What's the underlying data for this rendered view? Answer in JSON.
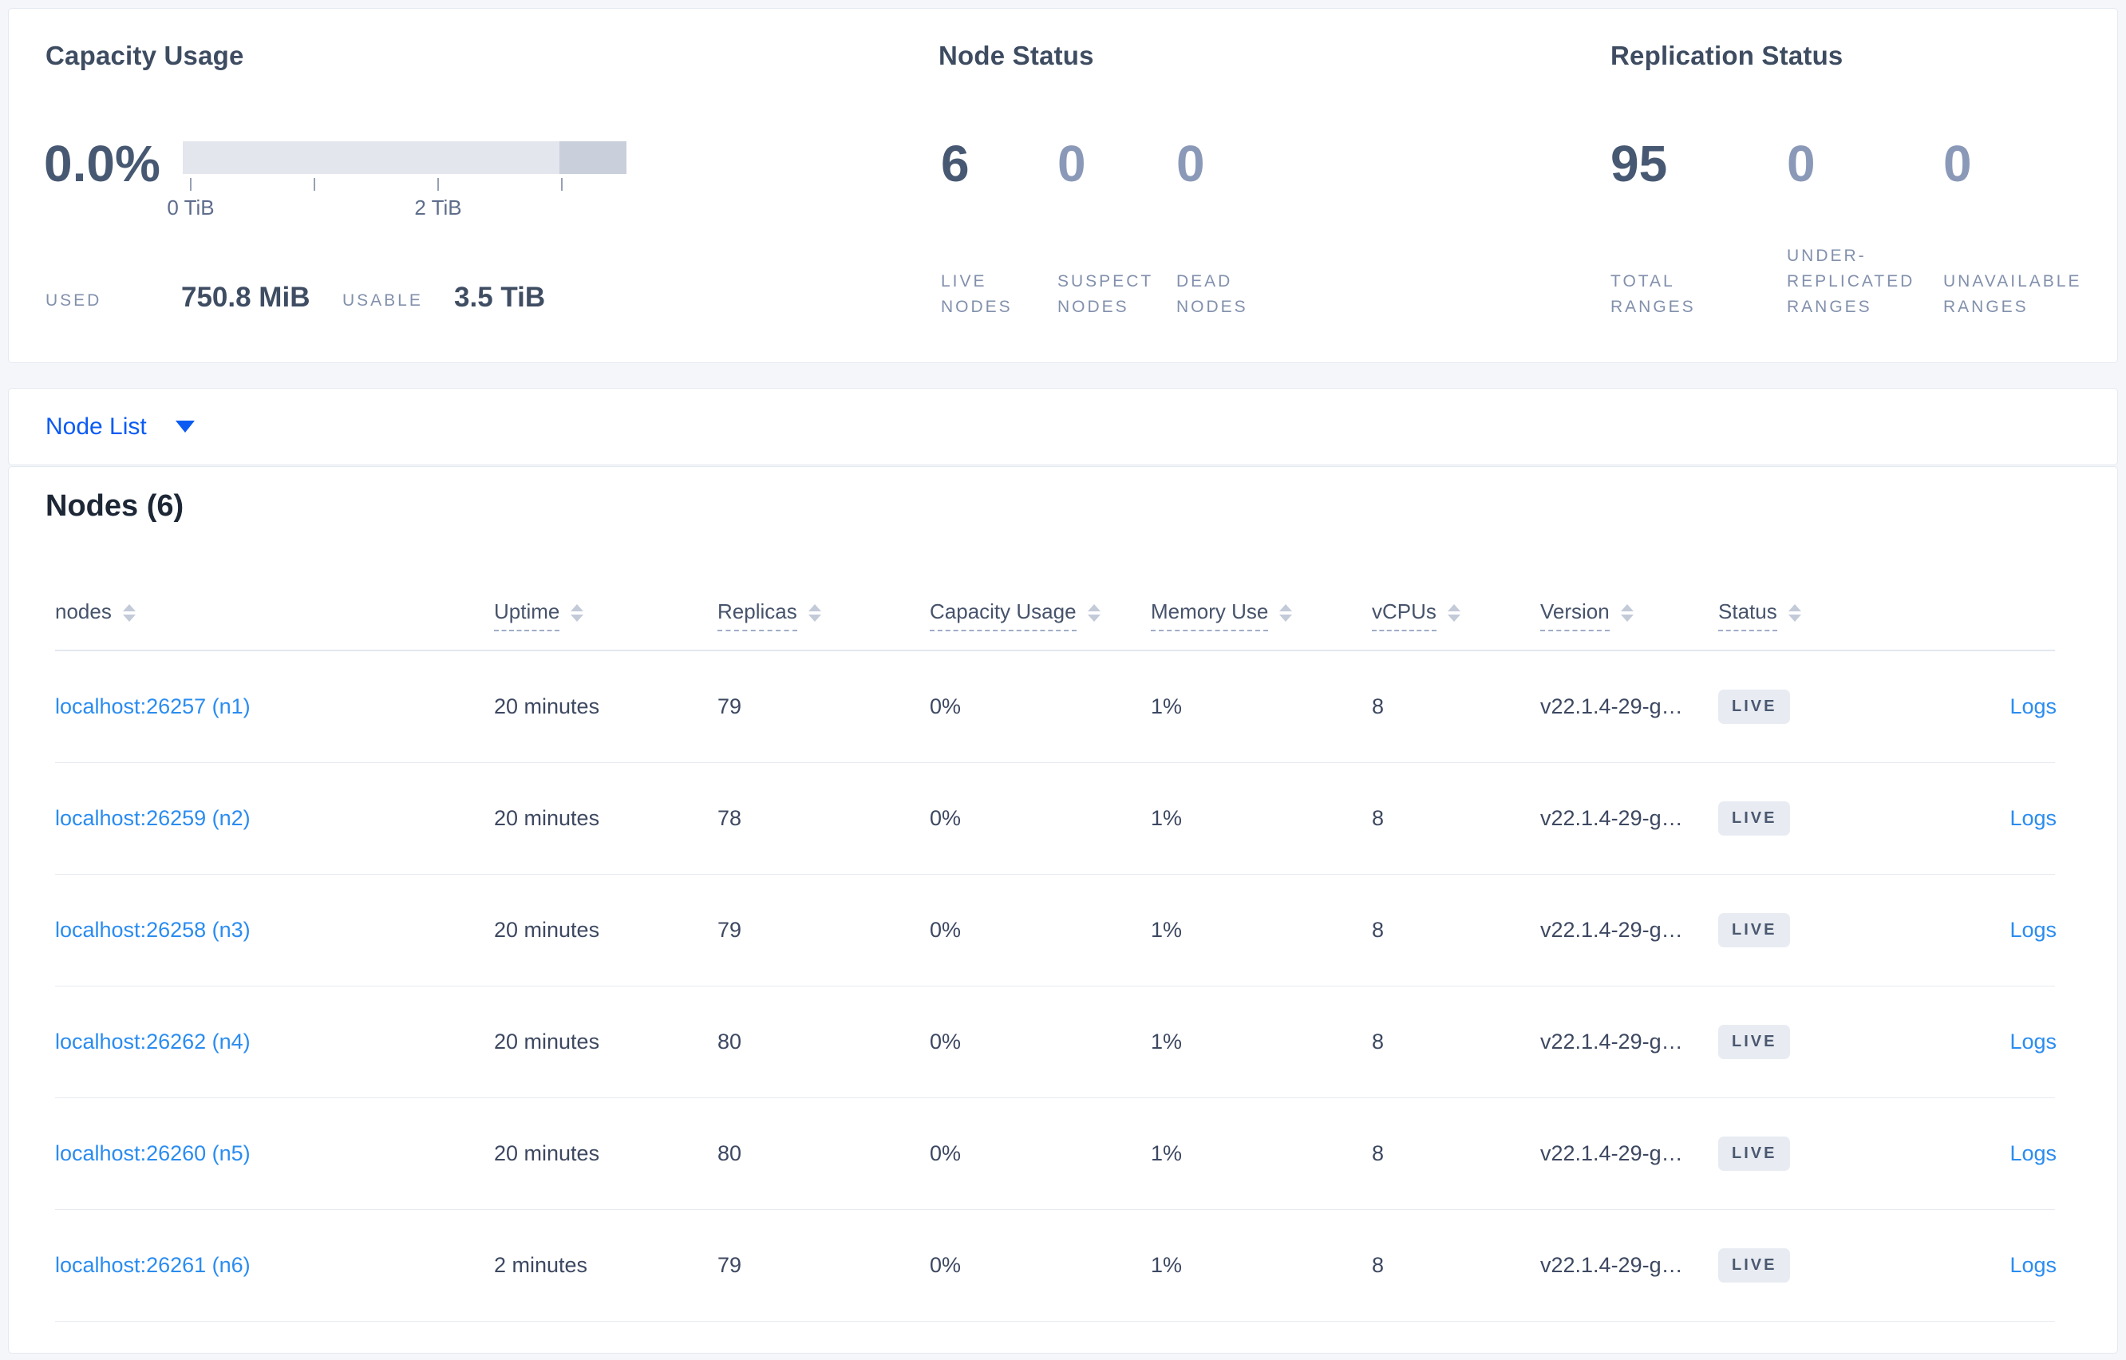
{
  "summary": {
    "capacity": {
      "title": "Capacity Usage",
      "percent": "0.0%",
      "tick_labels": [
        "0 TiB",
        "2 TiB"
      ],
      "used_label": "USED",
      "used_value": "750.8 MiB",
      "usable_label": "USABLE",
      "usable_value": "3.5 TiB"
    },
    "node_status": {
      "title": "Node Status",
      "live_value": "6",
      "live_label": "LIVE NODES",
      "suspect_value": "0",
      "suspect_label": "SUSPECT NODES",
      "dead_value": "0",
      "dead_label": "DEAD NODES"
    },
    "replication": {
      "title": "Replication Status",
      "total_value": "95",
      "total_label": "TOTAL RANGES",
      "under_value": "0",
      "under_label": "UNDER-REPLICATED RANGES",
      "unavailable_value": "0",
      "unavailable_label": "UNAVAILABLE RANGES"
    }
  },
  "node_list": {
    "selector_label": "Node List"
  },
  "nodes_table": {
    "heading": "Nodes (6)",
    "columns": {
      "nodes": "nodes",
      "uptime": "Uptime",
      "replicas": "Replicas",
      "capacity": "Capacity Usage",
      "memory": "Memory Use",
      "vcpus": "vCPUs",
      "version": "Version",
      "status": "Status"
    },
    "rows": [
      {
        "node": "localhost:26257 (n1)",
        "uptime": "20 minutes",
        "replicas": "79",
        "capacity": "0%",
        "memory": "1%",
        "vcpus": "8",
        "version": "v22.1.4-29-g…",
        "status": "LIVE",
        "logs": "Logs"
      },
      {
        "node": "localhost:26259 (n2)",
        "uptime": "20 minutes",
        "replicas": "78",
        "capacity": "0%",
        "memory": "1%",
        "vcpus": "8",
        "version": "v22.1.4-29-g…",
        "status": "LIVE",
        "logs": "Logs"
      },
      {
        "node": "localhost:26258 (n3)",
        "uptime": "20 minutes",
        "replicas": "79",
        "capacity": "0%",
        "memory": "1%",
        "vcpus": "8",
        "version": "v22.1.4-29-g…",
        "status": "LIVE",
        "logs": "Logs"
      },
      {
        "node": "localhost:26262 (n4)",
        "uptime": "20 minutes",
        "replicas": "80",
        "capacity": "0%",
        "memory": "1%",
        "vcpus": "8",
        "version": "v22.1.4-29-g…",
        "status": "LIVE",
        "logs": "Logs"
      },
      {
        "node": "localhost:26260 (n5)",
        "uptime": "20 minutes",
        "replicas": "80",
        "capacity": "0%",
        "memory": "1%",
        "vcpus": "8",
        "version": "v22.1.4-29-g…",
        "status": "LIVE",
        "logs": "Logs"
      },
      {
        "node": "localhost:26261 (n6)",
        "uptime": "2 minutes",
        "replicas": "79",
        "capacity": "0%",
        "memory": "1%",
        "vcpus": "8",
        "version": "v22.1.4-29-g…",
        "status": "LIVE",
        "logs": "Logs"
      }
    ]
  },
  "colors": {
    "accent_blue": "#0b5bf3",
    "link_blue": "#2a8cf0",
    "page_background": "#f4f6fa",
    "bar_light": "#e3e6ec",
    "bar_dark": "#c9cfdb",
    "badge_background": "#e8ecf2"
  }
}
